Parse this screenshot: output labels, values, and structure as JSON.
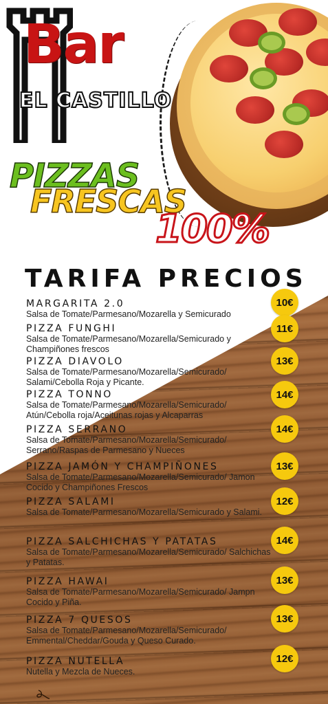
{
  "logo": {
    "bar": "Bar",
    "name": "EL CASTILLO"
  },
  "headline": {
    "line1": "PIZZAS",
    "line2": "FRESCAS",
    "line3": "100%"
  },
  "section_title": "TARIFA PRECIOS",
  "colors": {
    "price_badge": "#f6c90e",
    "brand_red": "#c81414",
    "green": "#6cbf1f",
    "yellow": "#f7c520"
  },
  "menu": [
    {
      "name": "MARGARITA 2.0",
      "desc": "Salsa de Tomate/Parmesano/Mozarella y Semicurado",
      "price": "10€"
    },
    {
      "name": "PIZZA FUNGHI",
      "desc": "Salsa de Tomate/Parmesano/Mozarella/Semicurado y Champiñones frescos",
      "price": "11€"
    },
    {
      "name": "PIZZA DIAVOLO",
      "desc": "Salsa de Tomate/Parmesano/Mozarella/Semicurado/ Salami/Cebolla Roja y Picante.",
      "price": "13€"
    },
    {
      "name": "PIZZA TONNO",
      "desc": "Salsa de Tomate/Parmesano/Mozarella/Semicurado/ Atún/Cebolla roja/Aceitunas rojas y Alcaparras",
      "price": "14€"
    },
    {
      "name": "PIZZA SERRANO",
      "desc": "Salsa de Tomate/Parmesano/Mozarella/Semicurado/ Serrano/Raspas de Parmesano y Nueces",
      "price": "14€"
    },
    {
      "name": "PIZZA JAMÓN Y CHAMPIÑONES",
      "desc": "Salsa de Tomate/Parmesano/Mozarella/Semicurado/ Jamon Cocido y Champiñones Frescos",
      "price": "13€"
    },
    {
      "name": "PIZZA SALAMI",
      "desc": "Salsa de Tomate/Parmesano/Mozarella/Semicurado y Salami.",
      "price": "12€"
    },
    {
      "name": "PIZZA SALCHICHAS Y PATATAS",
      "desc": "Salsa de Tomate/Parmesano/Mozarella/Semicurado/ Salchichas y Patatas.",
      "price": "14€"
    },
    {
      "name": "PIZZA HAWAI",
      "desc": "Salsa de Tomate/Parmesano/Mozarella/Semicurado/ Jampn Cocido y Piña.",
      "price": "13€"
    },
    {
      "name": "PIZZA 7 QUESOS",
      "desc": "Salsa de Tomate/Parmesano/Mozarella/Semicurado/ Emmental/Cheddar/Gouda y Queso Curado.",
      "price": "13€"
    },
    {
      "name": "PIZZA NUTELLA",
      "desc": "Nutella y Mezcla de Nueces.",
      "price": "12€"
    }
  ]
}
